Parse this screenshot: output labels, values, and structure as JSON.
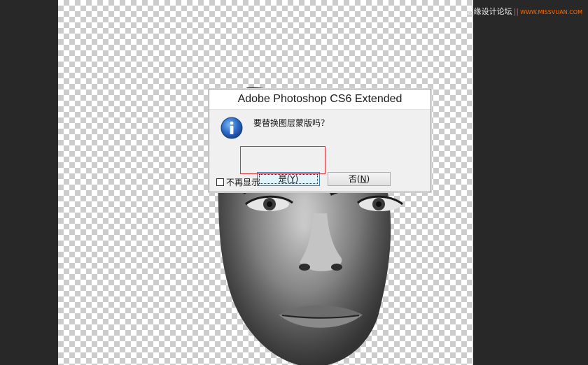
{
  "watermark": {
    "site_name": "思缘设计论坛",
    "separator": "||",
    "url": "WWW.MISSVUAN.COM"
  },
  "dialog": {
    "title": "Adobe Photoshop CS6 Extended",
    "icon": "info-icon",
    "message": "要替换图层蒙版吗？",
    "yes_button": {
      "label": "是(",
      "mnemonic": "Y",
      "suffix": ")"
    },
    "no_button": {
      "label": "否(",
      "mnemonic": "N",
      "suffix": ")"
    },
    "dont_show_label": "不再显示",
    "dont_show_checked": false
  },
  "colors": {
    "canvas_checker_dark": "#cccccc",
    "canvas_checker_light": "#ffffff",
    "workspace": "#282828",
    "highlight": "#e0303a",
    "info_icon_blue": "#1f5fb8"
  }
}
